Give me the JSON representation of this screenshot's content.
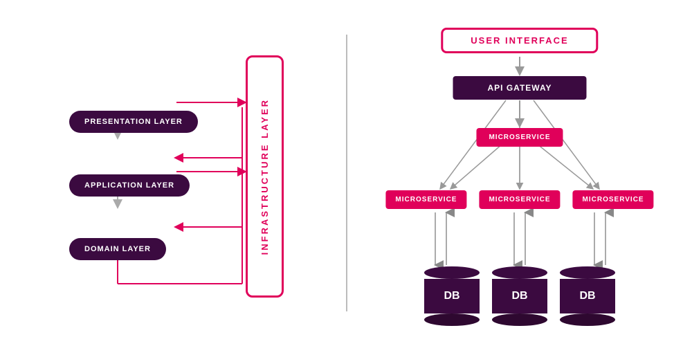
{
  "left": {
    "layers": [
      {
        "label": "PRESENTATION LAYER"
      },
      {
        "label": "APPLICATION LAYER"
      },
      {
        "label": "DOMAIN LAYER"
      }
    ],
    "infrastructure": "INFRASTRUCTURE\nLAYER",
    "infra_label": "INFRASTRUCTURE LAYER"
  },
  "right": {
    "ui_label": "USER INTERFACE",
    "api_label": "API GATEWAY",
    "ms_top": "MICROSERVICE",
    "ms_row": [
      "MICROSERVICE",
      "MICROSERVICE",
      "MICROSERVICE"
    ],
    "db_row": [
      "DB",
      "DB",
      "DB"
    ]
  },
  "colors": {
    "dark_purple": "#3b0a40",
    "pink": "#e0005a",
    "white": "#ffffff",
    "gray": "#999999"
  }
}
